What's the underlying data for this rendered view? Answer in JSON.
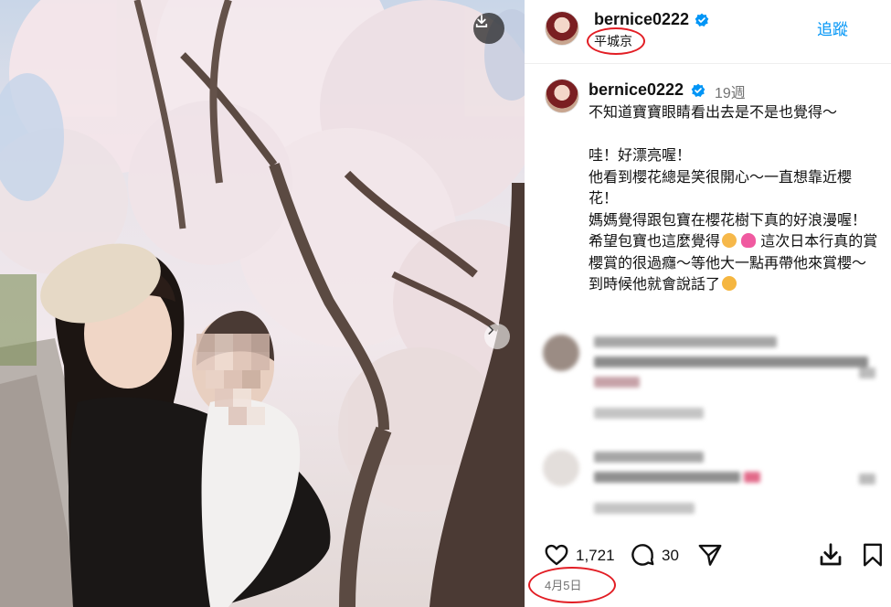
{
  "post": {
    "username": "bernice0222",
    "location": "平城京",
    "follow_label": "追蹤",
    "caption_time": "19週",
    "caption_text": "不知道寶寶眼睛看出去是不是也覺得～\n\n哇！好漂亮喔！\n他看到櫻花總是笑很開心～一直想靠近櫻花！\n媽媽覺得跟包寶在櫻花樹下真的好浪漫喔！希望包寶也這麼覺得",
    "caption_text_2": " 這次日本行真的賞櫻賞的很過癮～等他大一點再帶他來賞櫻～到時候他就會說話了",
    "like_count": "1,721",
    "comment_count": "30",
    "date": "4月5日"
  },
  "icons": {
    "download": "download-icon",
    "next": "chevron-right-icon",
    "verified": "verified-badge-icon",
    "like": "heart-icon",
    "comment": "comment-icon",
    "share": "send-icon",
    "save_download": "download-icon",
    "bookmark": "bookmark-icon",
    "emoji_smile": "smiling-face-emoji",
    "emoji_heart": "pink-heart-emoji",
    "emoji_laugh": "laughing-face-emoji"
  },
  "colors": {
    "link": "#0095f6",
    "verified": "#0095f6",
    "annotation": "#e21d24",
    "muted": "#737373"
  }
}
